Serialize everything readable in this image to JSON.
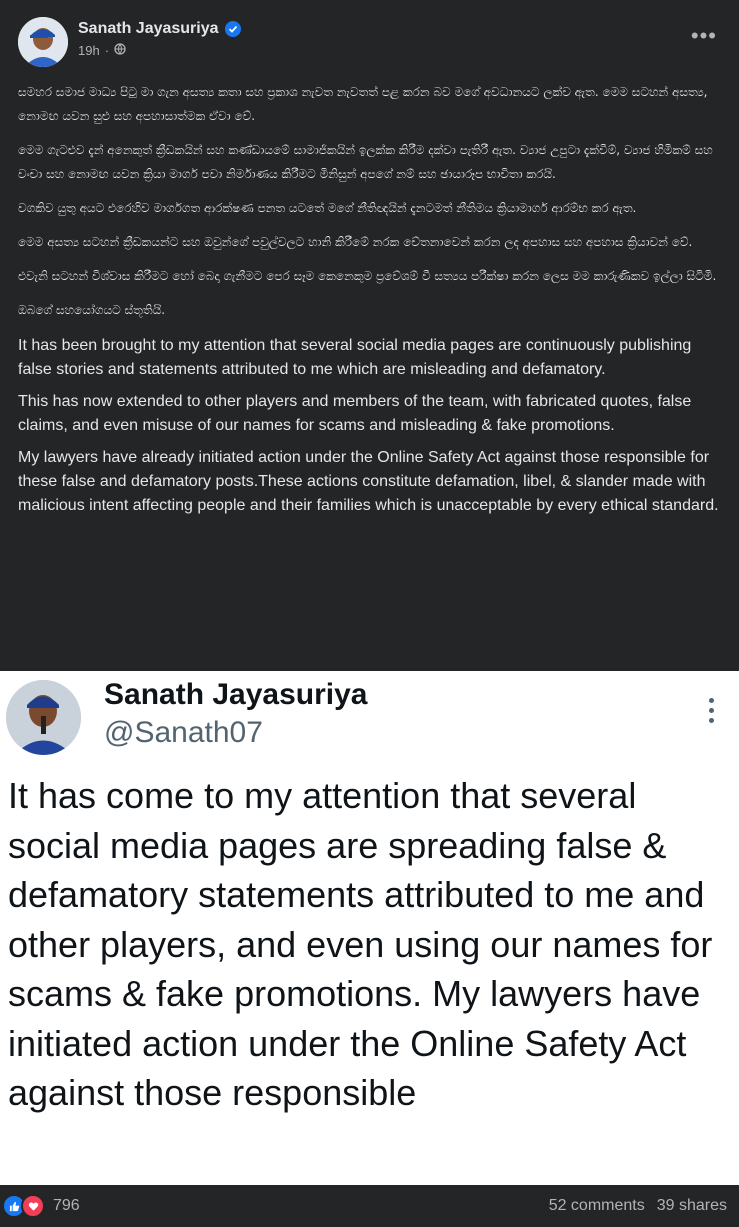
{
  "fb_post": {
    "author": "Sanath Jayasuriya",
    "time": "19h",
    "paragraphs_si": [
      "සමහර සමාජ මාධ්‍ය පිටු මා ගැන අසත්‍ය කතා සහ ප්‍රකාශ නැවත නැවතත් පළ කරන බව මගේ අවධානයට ලක්ව ඇත. මෙම සටහන් අසත්‍ය, නොමඟ යවන සුළු සහ අපහාසාත්මක ඒවා වේ.",
      "මෙම ගැටළුව දැන් අනෙකුත් ක්‍රීඩකයින් සහ කණ්ඩායමේ සාමාජිකයින් ඉලක්ක කිරීම දක්වා පැතිරී ඇත. ව්‍යාජ උපුටා දැක්වීම්, ව්‍යාජ හිමිකම් සහ වංචා සහ නොමඟ යවන ක්‍රියා මාර්ග පවා නිර්මාණය කිරීමට මිනිසුන් අපගේ නම් සහ ඡායාරූප භාවිතා කරයි.",
      "වගකිව යුතු අයට එරෙහිව මාර්ගගත ආරක්ෂණ පනත යටතේ මගේ නීතිඥයින් දැනටමත් නීතිමය ක්‍රියාමාර්ග ආරම්භ කර ඇත.",
      "මෙම අසත්‍ය සටහන් ක්‍රීඩකයන්ට සහ ඔවුන්ගේ පවුල්වලට හානි කිරීමේ නරක චේතනාවෙන් කරන ලද අපහාස සහ අපහාස ක්‍රියාවන් වේ.",
      "එවැනි සටහන් විශ්වාස කිරීමට හෝ බෙදා ගැනීමට පෙර සෑම කෙනෙකුම ප්‍රවේශම් වී සත්‍යය පරීක්ෂා කරන ලෙස මම කාරුණිකව ඉල්ලා සිටිමි.",
      "ඔබගේ  සහයෝගයට ස්තූතියි."
    ],
    "paragraphs_en": [
      "It has been brought to my attention that several social media pages are continuously publishing false stories and statements attributed to me which are misleading and defamatory.",
      "This has now extended to other players and members of the team, with fabricated quotes, false claims, and even misuse of our names for scams and misleading & fake promotions.",
      "My lawyers have already initiated action under the Online Safety Act against those responsible for these false and defamatory posts.These actions constitute defamation, libel, & slander made with malicious intent affecting people and their families which is unacceptable by every ethical standard."
    ]
  },
  "tweet": {
    "name": "Sanath Jayasuriya",
    "handle": "@Sanath07",
    "text": "It has come to my attention that several social media pages are spreading false & defamatory statements attributed to me and other players, and even using our names for scams & fake promotions. My lawyers have initiated action under the Online Safety Act against those responsible"
  },
  "footer": {
    "reaction_count": "796",
    "comments": "52 comments",
    "shares": "39 shares"
  },
  "colors": {
    "fb_bg": "#242526",
    "fb_text": "#e4e6eb",
    "fb_secondary": "#b0b3b8",
    "verified_blue": "#1877f2",
    "love_red": "#f33e58",
    "tw_text": "#0f1419",
    "tw_secondary": "#536471"
  }
}
